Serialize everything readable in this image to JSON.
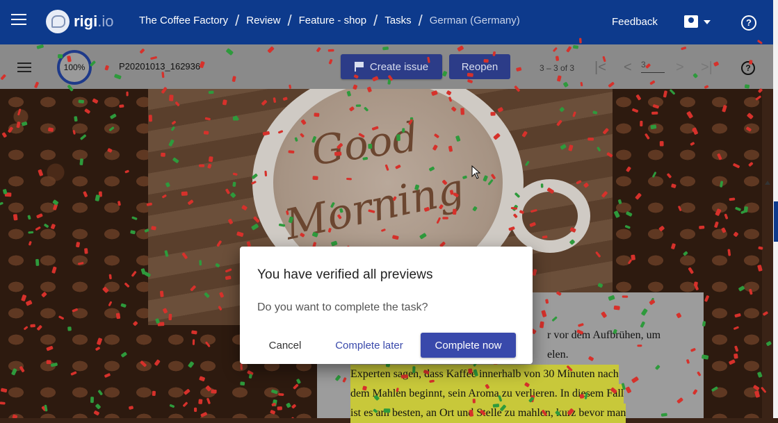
{
  "header": {
    "logo_text": "rigi",
    "logo_suffix": ".io",
    "breadcrumbs": [
      "The Coffee Factory",
      "Review",
      "Feature - shop",
      "Tasks",
      "German (Germany)"
    ],
    "feedback_label": "Feedback"
  },
  "toolbar": {
    "progress_label": "100%",
    "preview_id": "P20201013_162936",
    "create_issue_label": "Create issue",
    "reopen_label": "Reopen",
    "pager_text": "3 – 3 of 3",
    "page_input_value": "3"
  },
  "preview": {
    "image_text_line1": "Good",
    "image_text_line2": "Morning",
    "doc_line1": "r vor dem Aufbrühen, um",
    "doc_line2": "elen.",
    "doc_line3": "Experten sagen, dass Kaffee innerhalb von 30 Minuten nach",
    "doc_line4": "dem Mahlen beginnt, sein Aroma zu verlieren. In diesem Fall",
    "doc_line5": "ist es am besten, an Ort und Stelle zu mahlen, kurz bevor man"
  },
  "dialog": {
    "title": "You have verified all previews",
    "message": "Do you want to complete the task?",
    "cancel_label": "Cancel",
    "later_label": "Complete later",
    "now_label": "Complete now"
  },
  "colors": {
    "nav_bg": "#0d3a8c",
    "primary_button": "#3949ab",
    "confetti_red": "#d6312b",
    "confetti_green": "#2e9a3c"
  }
}
